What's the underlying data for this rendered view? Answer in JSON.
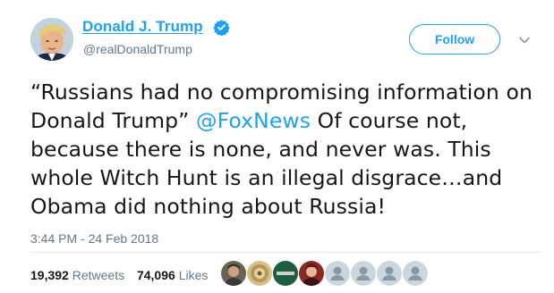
{
  "author": {
    "name": "Donald J. Trump",
    "handle": "@realDonaldTrump",
    "verified": true,
    "avatar_icon": "profile-photo"
  },
  "actions": {
    "follow_label": "Follow",
    "more_icon": "chevron-down-icon"
  },
  "tweet": {
    "text_before": "“Russians had no compromising information on Donald Trump” ",
    "mention": "@FoxNews",
    "text_after": "  Of course not, because there is none, and never was. This whole Witch Hunt is an illegal disgrace…and Obama did nothing about Russia!",
    "timestamp": "3:44 PM - 24 Feb 2018"
  },
  "stats": {
    "retweets_count": "19,392",
    "retweets_label": "Retweets",
    "likes_count": "74,096",
    "likes_label": "Likes"
  },
  "likers_avatars": [
    "photo",
    "photo",
    "logo",
    "photo",
    "default",
    "default",
    "default",
    "default",
    "default"
  ],
  "colors": {
    "accent": "#1da1f2",
    "text": "#14171a",
    "secondary": "#657786",
    "divider": "#e6ecf0"
  }
}
